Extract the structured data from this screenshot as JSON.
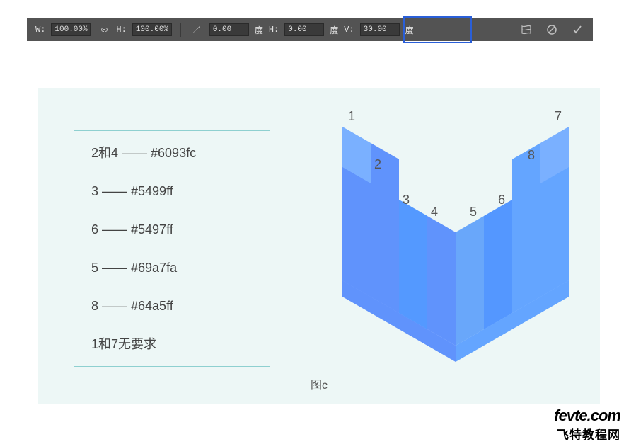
{
  "toolbar": {
    "w_label": "W:",
    "w_value": "100.00%",
    "h_label": "H:",
    "h_value": "100.00%",
    "angle_value": "0.00",
    "angle_unit": "度",
    "h2_label": "H:",
    "h2_value": "0.00",
    "h2_unit": "度",
    "v_label": "V:",
    "v_value": "30.00",
    "v_unit": "度"
  },
  "legend": {
    "row1": "2和4 —— #6093fc",
    "row2": "3 —— #5499ff",
    "row3": "6 —— #5497ff",
    "row4": "5 —— #69a7fa",
    "row5": "8 —— #64a5ff",
    "row6": "1和7无要求"
  },
  "shape_labels": {
    "n1": "1",
    "n2": "2",
    "n3": "3",
    "n4": "4",
    "n5": "5",
    "n6": "6",
    "n7": "7",
    "n8": "8"
  },
  "caption": "图c",
  "colors": {
    "c1": "#7ab0ff",
    "c2": "#6093fc",
    "c3": "#5499ff",
    "c4": "#6093fc",
    "c5": "#69a7fa",
    "c6": "#5497ff",
    "c7": "#7ab0ff",
    "c8": "#64a5ff"
  },
  "watermark": {
    "line1": "fevte.com",
    "line2": "飞特教程网"
  }
}
